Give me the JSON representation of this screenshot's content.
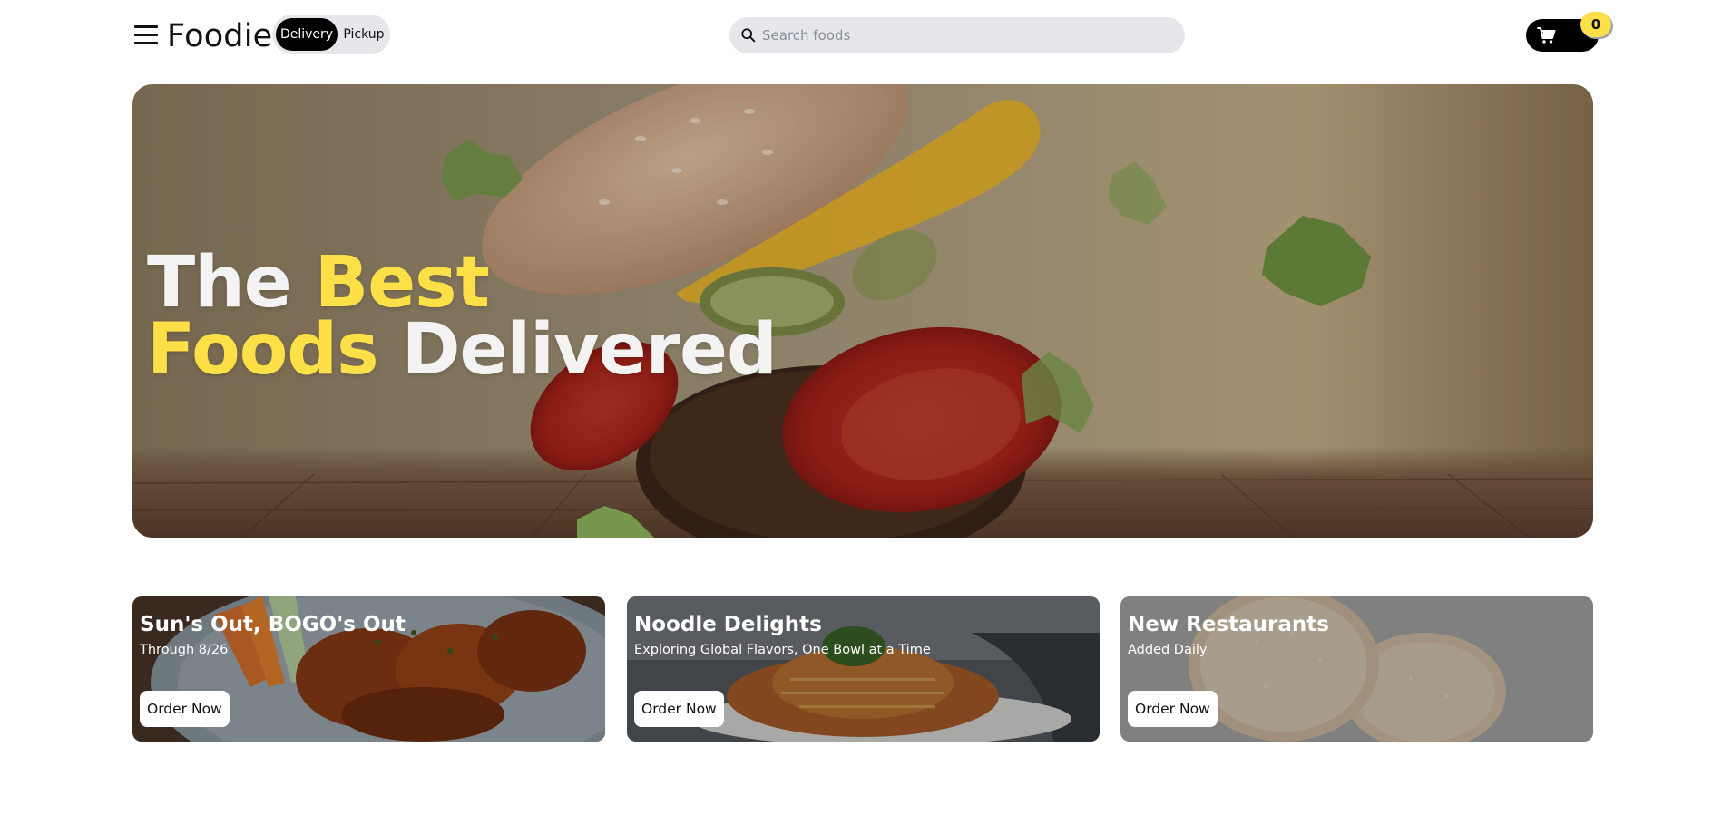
{
  "header": {
    "brand": "Foodie",
    "mode_toggle": {
      "delivery_label": "Delivery",
      "pickup_label": "Pickup",
      "selected": "Delivery"
    },
    "search": {
      "placeholder": "Search foods",
      "value": "",
      "icon": "search-icon"
    },
    "cart": {
      "icon": "cart-icon",
      "count": "0"
    },
    "menu_icon": "hamburger-menu-icon"
  },
  "hero": {
    "title_word1": "The",
    "title_word2": "Best",
    "title_word3": "Foods",
    "title_word4": "Delivered",
    "highlight_color": "#fde047"
  },
  "promos": [
    {
      "title": "Sun's Out, BOGO's Out",
      "subtitle": "Through 8/26",
      "button": "Order Now"
    },
    {
      "title": "Noodle Delights",
      "subtitle": "Exploring Global Flavors, One Bowl at a Time",
      "button": "Order Now"
    },
    {
      "title": "New Restaurants",
      "subtitle": "Added Daily",
      "button": "Order Now"
    }
  ],
  "colors": {
    "accent_yellow": "#fde047",
    "toggle_active_bg": "#000000",
    "search_bg": "#e5e7eb"
  }
}
